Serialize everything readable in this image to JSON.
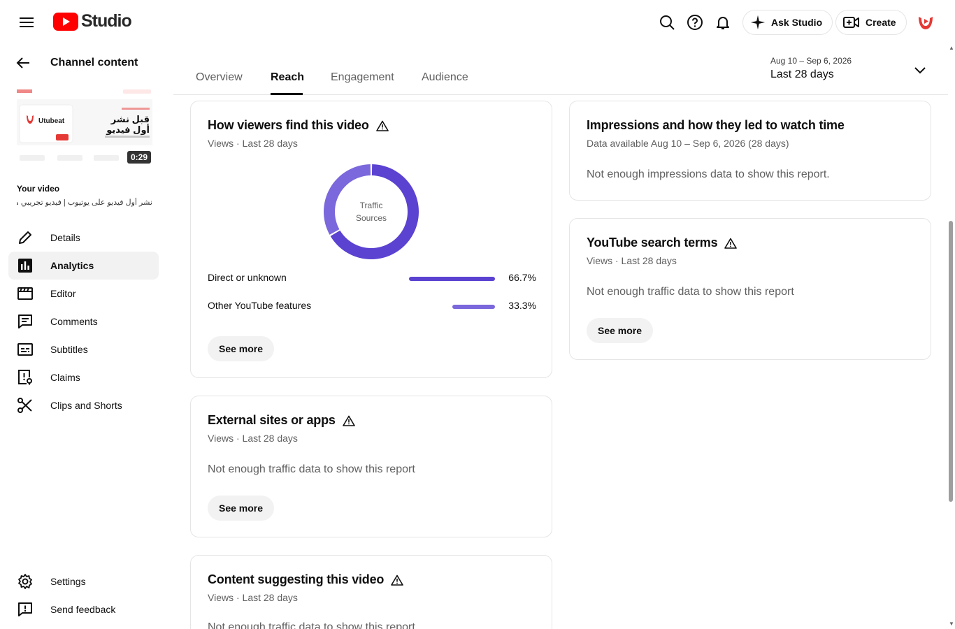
{
  "header": {
    "logo_text": "Studio",
    "ask_studio_label": "Ask Studio",
    "create_label": "Create"
  },
  "sidebar": {
    "back_label": "Channel content",
    "thumbnail": {
      "brand": "Utubeat",
      "arabic_line1": "قبل نشر",
      "arabic_line2": "أول فيديو",
      "duration": "0:29"
    },
    "your_video_label": "Your video",
    "video_title": "نشر أول فيديو على يوتيوب | فيديو تجريبي من ...",
    "items": [
      {
        "label": "Details",
        "icon": "pencil-icon"
      },
      {
        "label": "Analytics",
        "icon": "analytics-icon",
        "active": true
      },
      {
        "label": "Editor",
        "icon": "clapperboard-icon"
      },
      {
        "label": "Comments",
        "icon": "comment-icon"
      },
      {
        "label": "Subtitles",
        "icon": "subtitles-icon"
      },
      {
        "label": "Claims",
        "icon": "claims-icon"
      },
      {
        "label": "Clips and Shorts",
        "icon": "scissors-icon"
      }
    ],
    "bottom_items": [
      {
        "label": "Settings",
        "icon": "gear-icon"
      },
      {
        "label": "Send feedback",
        "icon": "feedback-icon"
      }
    ]
  },
  "tabs": {
    "items": [
      "Overview",
      "Reach",
      "Engagement",
      "Audience"
    ],
    "active": "Reach",
    "date_range_small": "Aug 10 – Sep 6, 2026",
    "date_range_label": "Last 28 days"
  },
  "cards": {
    "traffic": {
      "title": "How viewers find this video",
      "subtitle": "Views · Last 28 days",
      "donut_label_line1": "Traffic",
      "donut_label_line2": "Sources",
      "sources": [
        {
          "name": "Direct or unknown",
          "value_text": "66.7%",
          "value": 66.7,
          "color": "#5b42d1"
        },
        {
          "name": "Other YouTube features",
          "value_text": "33.3%",
          "value": 33.3,
          "color": "#7a68dc"
        }
      ],
      "see_more": "See more"
    },
    "external": {
      "title": "External sites or apps",
      "subtitle": "Views · Last 28 days",
      "message": "Not enough traffic data to show this report",
      "see_more": "See more"
    },
    "suggesting": {
      "title": "Content suggesting this video",
      "subtitle": "Views · Last 28 days",
      "message": "Not enough traffic data to show this report"
    },
    "impressions": {
      "title": "Impressions and how they led to watch time",
      "subtitle": "Data available Aug 10 – Sep 6, 2026 (28 days)",
      "message": "Not enough impressions data to show this report."
    },
    "search_terms": {
      "title": "YouTube search terms",
      "subtitle": "Views · Last 28 days",
      "message": "Not enough traffic data to show this report",
      "see_more": "See more"
    }
  }
}
